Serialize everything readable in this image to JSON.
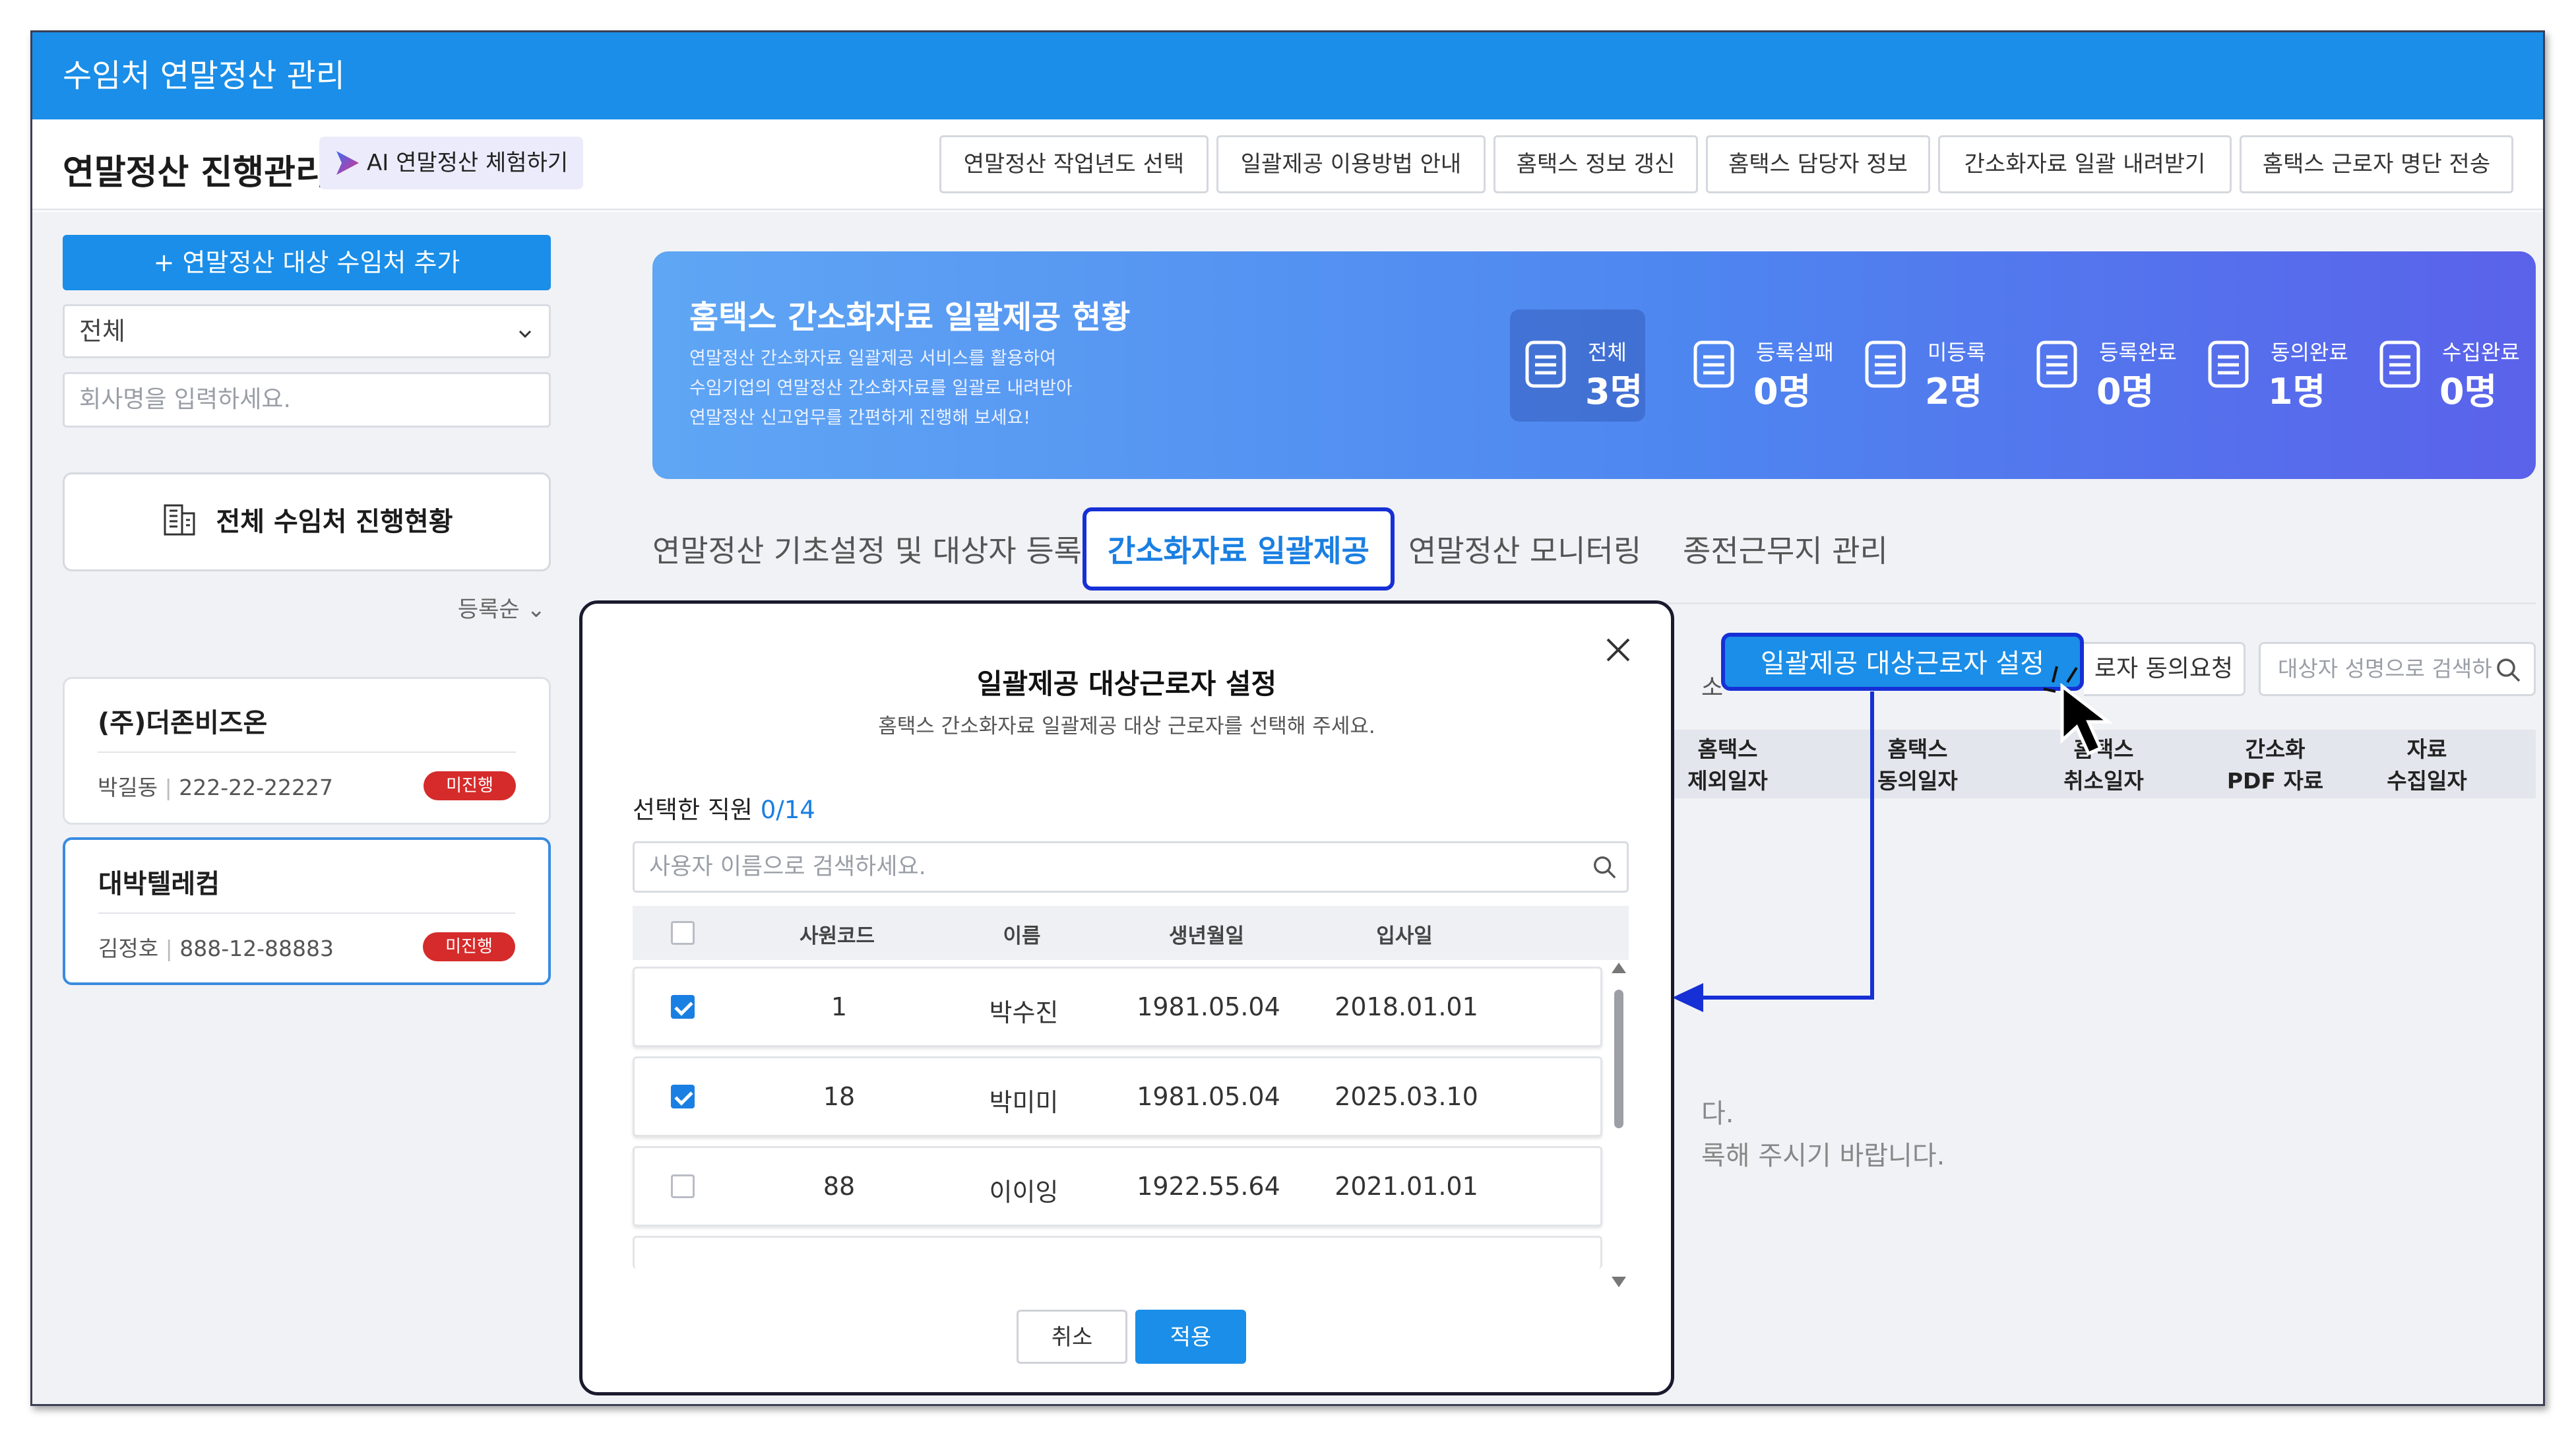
{
  "app": {
    "title": "수임처 연말정산 관리"
  },
  "header": {
    "title": "연말정산 진행관리",
    "ai_chip": "AI 연말정산 체험하기",
    "buttons": [
      "연말정산 작업년도 선택",
      "일괄제공 이용방법 안내",
      "홈택스 정보 갱신",
      "홈택스 담당자 정보",
      "간소화자료 일괄 내려받기",
      "홈택스 근로자 명단 전송"
    ]
  },
  "sidebar": {
    "add_button": "+ 연말정산 대상 수임처 추가",
    "filter_value": "전체",
    "search_placeholder": "회사명을 입력하세요.",
    "status_button": "전체 수임처 진행현황",
    "sort_label": "등록순",
    "companies": [
      {
        "name": "(주)더존비즈온",
        "owner": "박길동",
        "biz_no": "222-22-22227",
        "badge": "미진행"
      },
      {
        "name": "대박텔레컴",
        "owner": "김정호",
        "biz_no": "888-12-88883",
        "badge": "미진행"
      }
    ]
  },
  "banner": {
    "title": "홈택스 간소화자료 일괄제공 현황",
    "desc": [
      "연말정산 간소화자료 일괄제공 서비스를 활용하여",
      "수임기업의 연말정산 간소화자료를 일괄로 내려받아",
      "연말정산 신고업무를 간편하게 진행해 보세요!"
    ],
    "stats": [
      {
        "label": "전체",
        "value": "3명"
      },
      {
        "label": "등록실패",
        "value": "0명"
      },
      {
        "label": "미등록",
        "value": "2명"
      },
      {
        "label": "등록완료",
        "value": "0명"
      },
      {
        "label": "동의완료",
        "value": "1명"
      },
      {
        "label": "수집완료",
        "value": "0명"
      }
    ]
  },
  "tabs": [
    {
      "label": "연말정산 기초설정 및 대상자 등록",
      "active": false
    },
    {
      "label": "간소화자료 일괄제공",
      "active": true
    },
    {
      "label": "연말정산 모니터링",
      "active": false
    },
    {
      "label": "종전근무지 관리",
      "active": false
    }
  ],
  "toolbar": {
    "partial_left": "소",
    "target_button": "일괄제공 대상근로자 설정",
    "consent_button": "로자 동의요청",
    "search_placeholder": "대상자 성명으로 검색하"
  },
  "table": {
    "headers": [
      [
        "홈택스",
        "제외일자"
      ],
      [
        "홈택스",
        "동의일자"
      ],
      [
        "홈택스",
        "취소일자"
      ],
      [
        "간소화",
        "PDF 자료"
      ],
      [
        "자료",
        "수집일자"
      ]
    ],
    "empty_lines": [
      "다.",
      "록해 주시기 바랍니다."
    ]
  },
  "modal": {
    "title": "일괄제공 대상근로자 설정",
    "subtitle": "홈택스 간소화자료 일괄제공 대상 근로자를 선택해 주세요.",
    "selected_label": "선택한 직원",
    "selected_count": "0/14",
    "search_placeholder": "사용자 이름으로 검색하세요.",
    "columns": [
      "사원코드",
      "이름",
      "생년월일",
      "입사일"
    ],
    "rows": [
      {
        "checked": true,
        "code": "1",
        "name": "박수진",
        "birth": "1981.05.04",
        "join": "2018.01.01"
      },
      {
        "checked": true,
        "code": "18",
        "name": "박미미",
        "birth": "1981.05.04",
        "join": "2025.03.10"
      },
      {
        "checked": false,
        "code": "88",
        "name": "이이잉",
        "birth": "1922.55.64",
        "join": "2021.01.01"
      }
    ],
    "cancel": "취소",
    "apply": "적용"
  },
  "colors": {
    "primary": "#1a8ee8",
    "highlight_border": "#1630d6",
    "badge": "#d62b2b"
  }
}
